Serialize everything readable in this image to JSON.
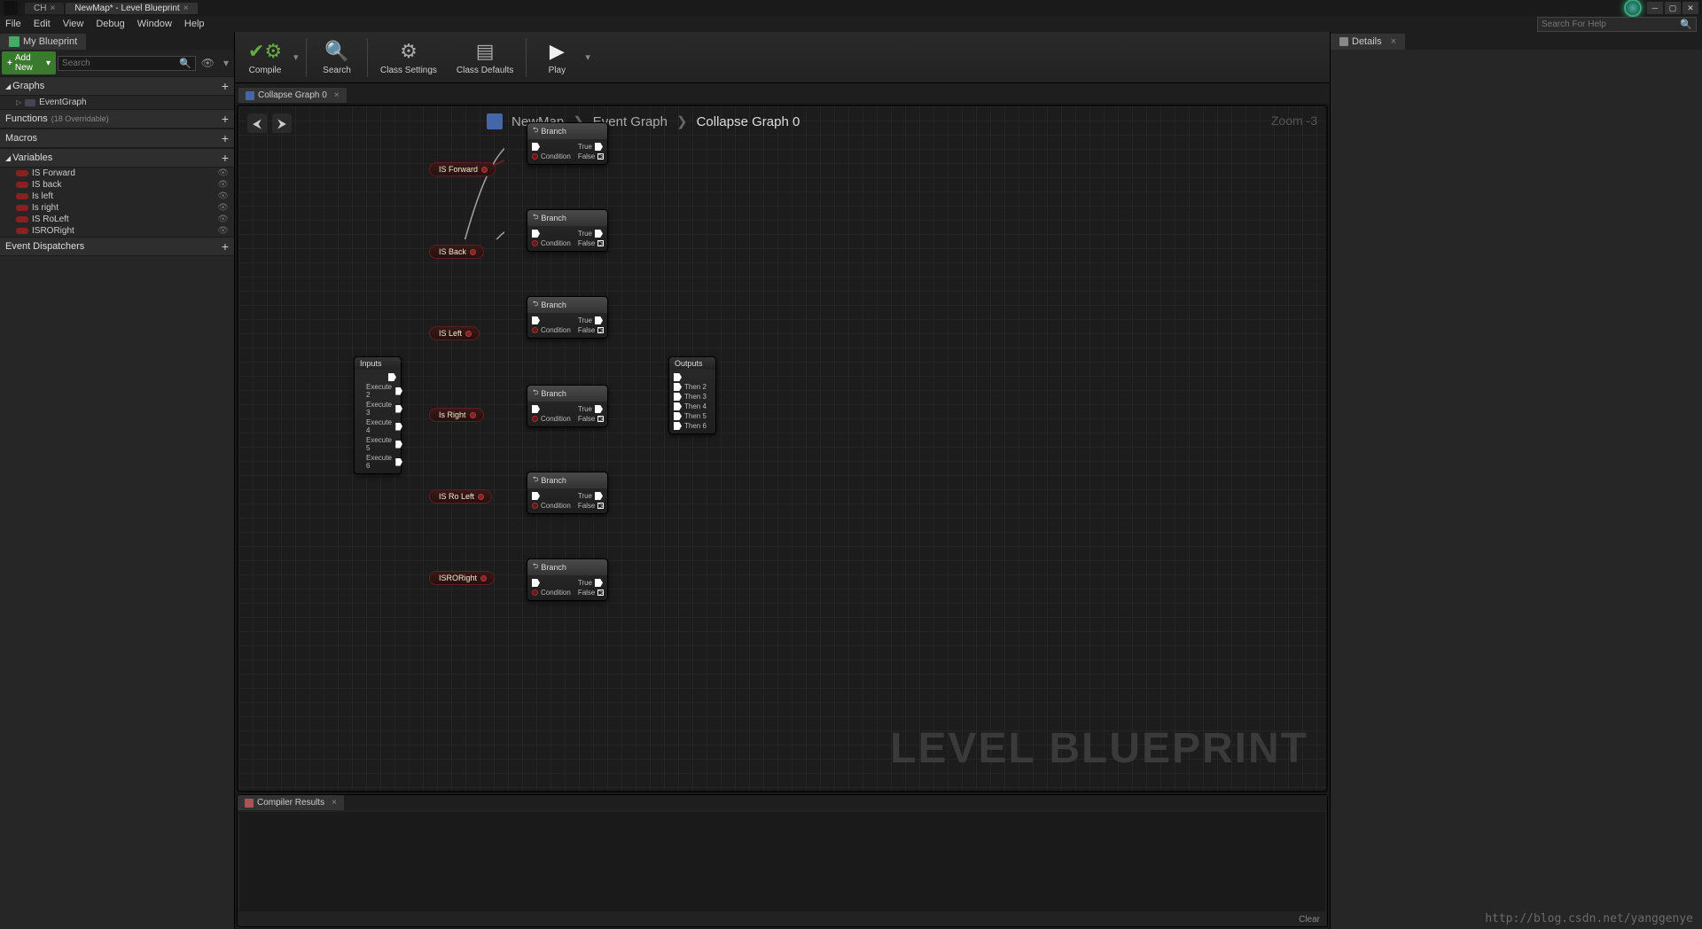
{
  "titlebar": {
    "tabs": [
      {
        "label": "CH"
      },
      {
        "label": "NewMap* - Level Blueprint"
      }
    ],
    "search_help_placeholder": "Search For Help"
  },
  "menubar": {
    "items": [
      "File",
      "Edit",
      "View",
      "Debug",
      "Window",
      "Help"
    ]
  },
  "left_panel": {
    "tab_label": "My Blueprint",
    "add_new_label": "Add New",
    "search_placeholder": "Search",
    "sections": {
      "graphs": {
        "label": "Graphs",
        "items": [
          "EventGraph"
        ]
      },
      "functions": {
        "label": "Functions",
        "sub": "(18 Overridable)"
      },
      "macros": {
        "label": "Macros"
      },
      "variables": {
        "label": "Variables",
        "items": [
          "IS Forward",
          "IS back",
          "Is left",
          "Is right",
          "IS RoLeft",
          "ISRORight"
        ]
      },
      "dispatchers": {
        "label": "Event Dispatchers"
      }
    }
  },
  "toolbar": {
    "compile": "Compile",
    "search": "Search",
    "class_settings": "Class Settings",
    "class_defaults": "Class Defaults",
    "play": "Play"
  },
  "graph": {
    "tab_label": "Collapse Graph 0",
    "breadcrumb": [
      "NewMap",
      "Event Graph",
      "Collapse Graph 0"
    ],
    "zoom_label": "Zoom -3",
    "watermark": "LEVEL BLUEPRINT",
    "inputs_node": {
      "title": "Inputs",
      "pins": [
        "",
        "Execute 2",
        "Execute 3",
        "Execute 4",
        "Execute 5",
        "Execute 6"
      ]
    },
    "outputs_node": {
      "title": "Outputs",
      "pins": [
        "",
        "Then 2",
        "Then 3",
        "Then 4",
        "Then 5",
        "Then 6"
      ]
    },
    "branch_label": "Branch",
    "branch_pins": {
      "cond": "Condition",
      "true": "True",
      "false": "False"
    },
    "var_nodes": [
      "IS Forward",
      "IS Back",
      "IS Left",
      "Is Right",
      "IS Ro Left",
      "ISRORight"
    ]
  },
  "compiler": {
    "tab_label": "Compiler Results",
    "clear": "Clear"
  },
  "details": {
    "tab_label": "Details"
  },
  "footer_url": "http://blog.csdn.net/yanggenye"
}
